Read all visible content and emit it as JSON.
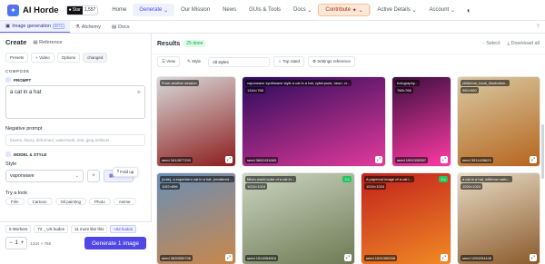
{
  "header": {
    "brand": "AI Horde",
    "star_label": "Star",
    "star_count": "1,557",
    "nav": [
      "Home",
      "Generate",
      "Our Mission",
      "News",
      "GUIs & Tools",
      "Docs",
      "Contribute",
      "Active Details",
      "Account"
    ],
    "dropdown_marks": [
      "⌄",
      "⌄",
      "⌄",
      "⌄",
      "⌄"
    ],
    "contribute_icon": "✦"
  },
  "tabs": {
    "image": "Image generation",
    "beta": "BETA",
    "alchemy": "Alchemy",
    "docs": "Docs",
    "help": "?"
  },
  "create": {
    "title": "Create",
    "reference": "Reference",
    "tools": [
      "Presets",
      "+ Video",
      "Options",
      "changed"
    ],
    "compose": "COMPOSE",
    "prompt_label": "PROMPT",
    "prompt_value": "a cat in a hat",
    "neg_label": "Negative prompt",
    "neg_placeholder": "lowres, blurry, deformed, watermark, text, jpeg artifacts",
    "model_style": "MODEL & STYLE",
    "style_label": "Style",
    "style_value": "vaporwave",
    "browse": "Browse",
    "fold_up": "Fold up",
    "try_label": "Try a look",
    "try_chips": [
      "Film",
      "Cartoon",
      "Oil painting",
      "Photo",
      "Anime"
    ],
    "workers": "5 Workers",
    "kudos_info": "72 _ US kudos",
    "more_info": "11 more like this",
    "kudos_badge": "≈62 kudos",
    "count": "1",
    "dims": "1344 × 768",
    "generate": "Generate 1 image"
  },
  "results": {
    "title": "Results",
    "done": "25 done",
    "select": "Select",
    "download": "Download all",
    "view": "View",
    "style": "Style",
    "style_select": "All styles",
    "top_rated": "Top rated",
    "settings_ref": "Settings reference"
  },
  "cards": [
    {
      "badge": "From another session",
      "dim": "",
      "seed": "seed 3412877203",
      "from": "#d9d9d9",
      "to": "#8c1d1d"
    },
    {
      "badge": "vaporwave synthwave style a cat in a hat, cyberpunk, neon, vi...",
      "dim": "1344×768",
      "seed": "seed 3682431663",
      "from": "#2a0b5a",
      "to": "#e23a9a"
    },
    {
      "badge": "holography...",
      "dim": "768×768",
      "seed": "seed 1991330557",
      "from": "#3b0f3f",
      "to": "#ff3aa5"
    },
    {
      "badge": "childrens_book_illustration...",
      "dim": "960×960",
      "seed": "seed 3911426623",
      "from": "#d9c9a3",
      "to": "#b5651d"
    },
    {
      "badge": "(cute), a superhero cat in a hat, (rendered ...",
      "dim": "1152×896",
      "seed": "seed 3830550706",
      "from": "#6a8fb8",
      "to": "#c9874a"
    },
    {
      "badge": "Micro world cube of a cat in...",
      "dim": "1024×1024",
      "seed": "seed 1514054816",
      "from": "#cbd5c0",
      "to": "#6f7a55",
      "green": "3.1"
    },
    {
      "badge": "A papercut image of a cat i...",
      "dim": "1024×1024",
      "seed": "seed 1091350008",
      "from": "#c2211d",
      "to": "#f08a24",
      "green": "3.1"
    },
    {
      "badge": "a cat in a hat, withhow carto...",
      "dim": "1024×1024",
      "seed": "seed 1090254445",
      "from": "#e8dcc5",
      "to": "#8a5a2b"
    }
  ],
  "colors": {
    "accent": "#4f46e5",
    "success": "#16a34a"
  }
}
